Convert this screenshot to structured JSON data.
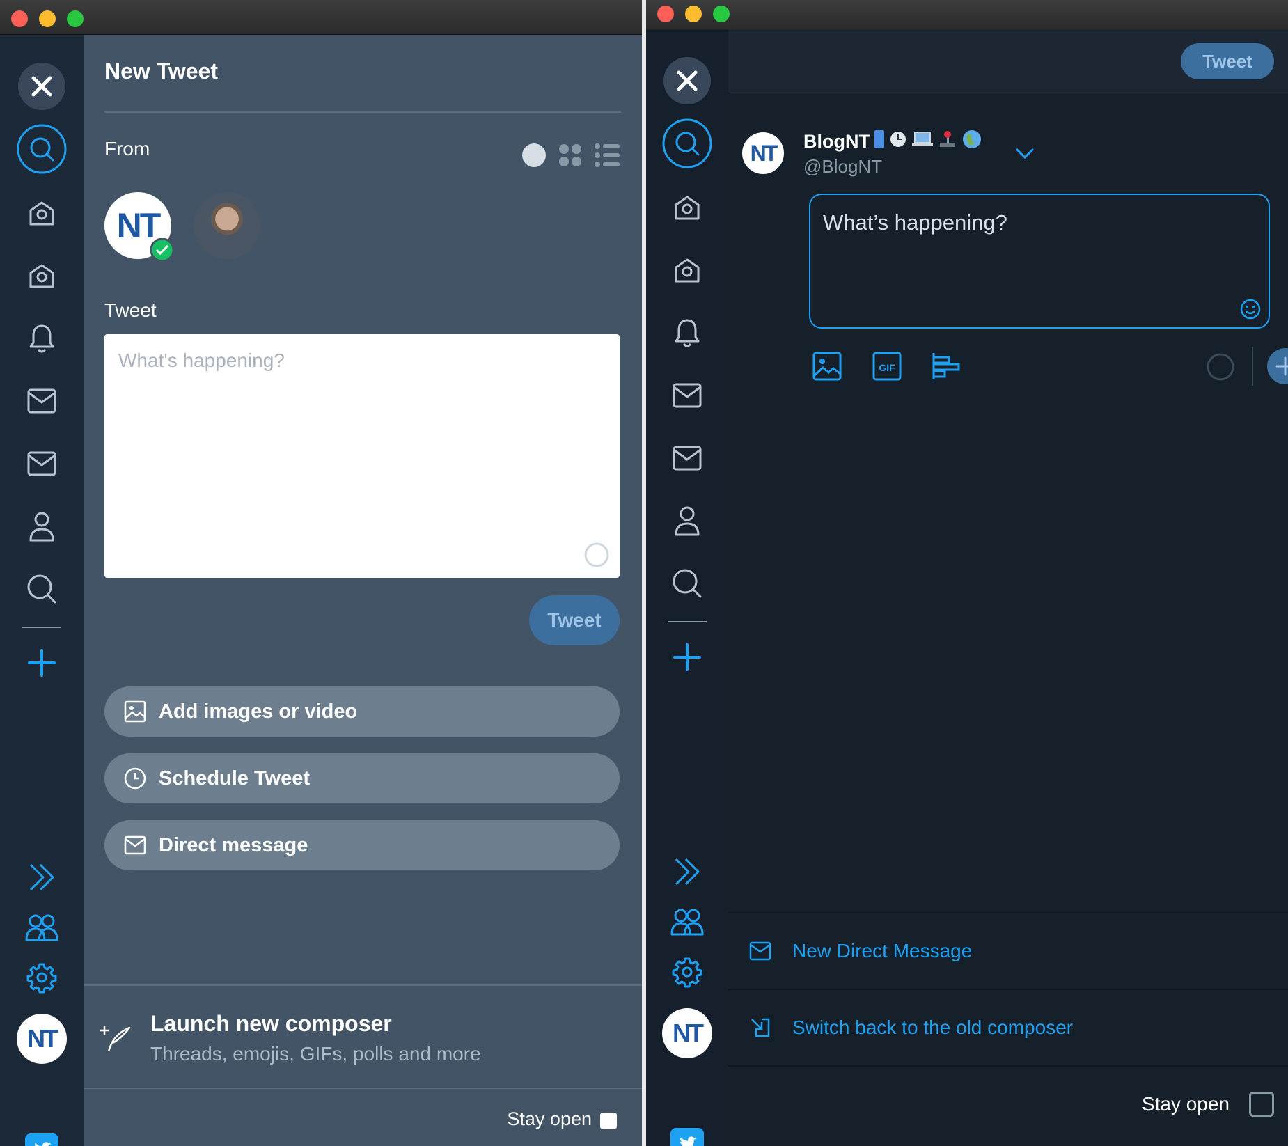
{
  "left_window": {
    "panel_title": "New Tweet",
    "from_label": "From",
    "tweet_label": "Tweet",
    "tweet_placeholder": "What's happening?",
    "tweet_button": "Tweet",
    "actions": [
      "Add images or video",
      "Schedule Tweet",
      "Direct message"
    ],
    "launch_title": "Launch new composer",
    "launch_subtitle": "Threads, emojis, GIFs, polls and more",
    "stay_open": "Stay open",
    "avatar_logo_text": "NT"
  },
  "right_window": {
    "tweet_button": "Tweet",
    "account_name": "BlogNT",
    "account_handle": "@BlogNT",
    "compose_placeholder": "What’s happening?",
    "new_dm": "New Direct Message",
    "switch_back": "Switch back to the old composer",
    "stay_open": "Stay open",
    "avatar_logo_text": "NT"
  },
  "colors": {
    "accent": "#1da1f2",
    "panel_bg": "#425465",
    "dark_bg": "#15202b",
    "verified": "#17bf63"
  }
}
